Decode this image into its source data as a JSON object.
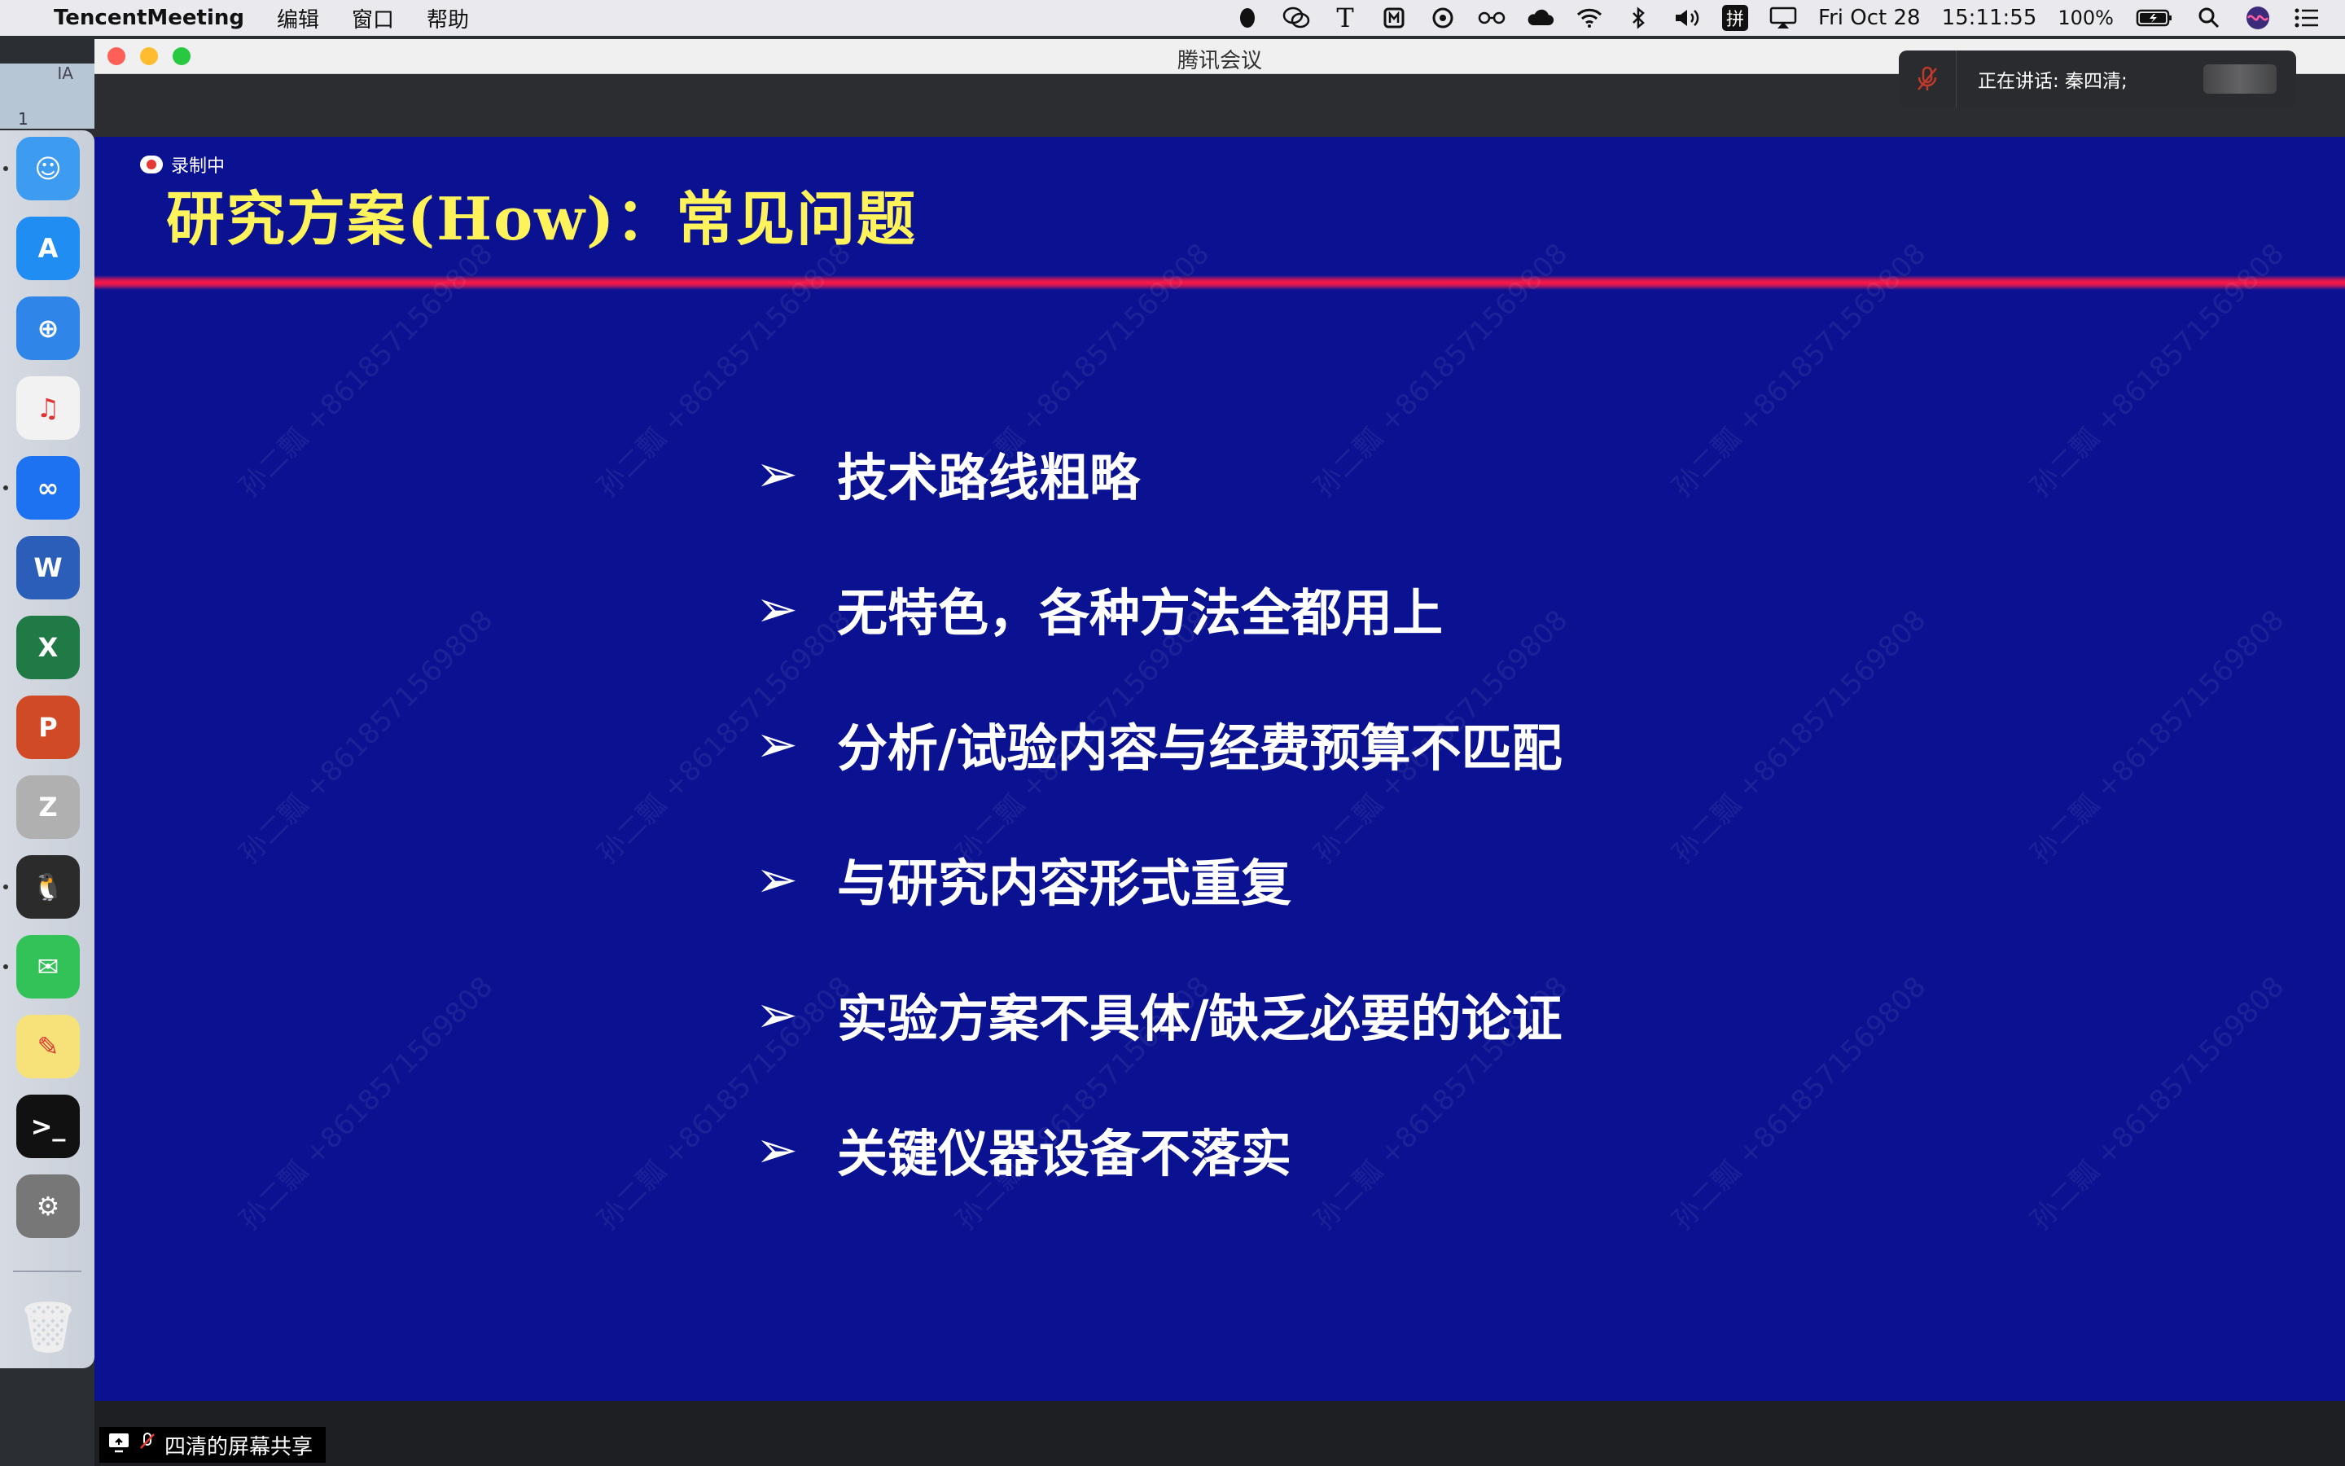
{
  "menubar": {
    "app_name": "TencentMeeting",
    "menus": [
      "编辑",
      "窗口",
      "帮助"
    ],
    "status_text": {
      "datetime_day": "Fri Oct 28",
      "time": "15:11:55",
      "battery": "100%"
    },
    "status_icons": [
      "qq-icon",
      "wechat-icon",
      "typora-icon",
      "m-icon",
      "sync-icon",
      "glasses-icon",
      "cloud-icon",
      "wifi-icon",
      "bluetooth-icon",
      "volume-icon",
      "input-method-icon",
      "airplay-icon",
      "battery-icon",
      "search-icon",
      "siri-icon",
      "control-center-icon"
    ],
    "input_method_label": "拼"
  },
  "top_left": {
    "label": "IA",
    "number": "1"
  },
  "dock": {
    "apps": [
      {
        "name": "finder-icon",
        "color": "#3d9bf0",
        "glyph": "☺"
      },
      {
        "name": "app-store-icon",
        "color": "#1f8df2",
        "glyph": "A"
      },
      {
        "name": "safari-icon",
        "color": "#2f86e8",
        "glyph": "⊕"
      },
      {
        "name": "music-icon",
        "color": "#f2f2f2",
        "glyph": "♫"
      },
      {
        "name": "tencent-meeting-icon",
        "color": "#1d72f2",
        "glyph": "∞"
      },
      {
        "name": "word-icon",
        "color": "#2b5eb8",
        "glyph": "W"
      },
      {
        "name": "excel-icon",
        "color": "#1f7a45",
        "glyph": "X"
      },
      {
        "name": "powerpoint-icon",
        "color": "#d04a26",
        "glyph": "P"
      },
      {
        "name": "zotero-icon",
        "color": "#b0b0b0",
        "glyph": "Z"
      },
      {
        "name": "qq-icon",
        "color": "#2b2b2b",
        "glyph": "🐧"
      },
      {
        "name": "wechat-icon",
        "color": "#33c258",
        "glyph": "✉"
      },
      {
        "name": "stickies-icon",
        "color": "#f7e27a",
        "glyph": "✎"
      },
      {
        "name": "terminal-icon",
        "color": "#111111",
        "glyph": ">_"
      },
      {
        "name": "system-preferences-icon",
        "color": "#777777",
        "glyph": "⚙"
      }
    ],
    "trash_glyph": "🗑"
  },
  "window": {
    "title": "腾讯会议",
    "speaker_label": "正在讲话: 秦四清;",
    "share_label": "四清的屏幕共享"
  },
  "slide": {
    "recording_label": "录制中",
    "title": "研究方案(How)：常见问题",
    "arrow_glyph": "➢",
    "bullets": [
      "技术路线粗略",
      "无特色，各种方法全都用上",
      "分析/试验内容与经费预算不匹配",
      "与研究内容形式重复",
      "实验方案不具体/缺乏必要的论证",
      "关键仪器设备不落实"
    ],
    "watermark": "孙二瓢 +8618571569808"
  },
  "colors": {
    "slide_bg": "#0a1291",
    "title": "#fff35c",
    "bullet_text": "#ffffff",
    "accent_line": "#ff1744"
  }
}
